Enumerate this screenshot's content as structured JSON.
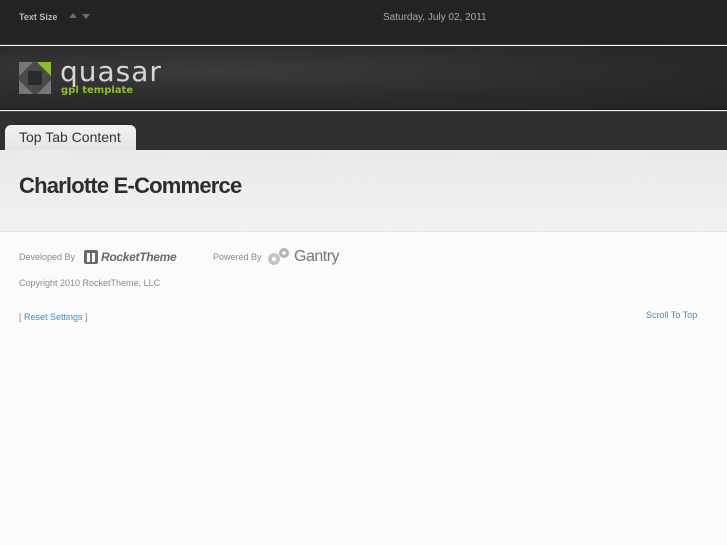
{
  "topbar": {
    "text_size_label": "Text Size",
    "date": "Saturday, July 02, 2011"
  },
  "logo": {
    "name": "quasar",
    "subtitle": "gpl template"
  },
  "tabs": [
    {
      "label": "Top Tab Content"
    }
  ],
  "page": {
    "title": "Charlotte E-Commerce"
  },
  "footer": {
    "developed_by": "Developed By",
    "developer": "RocketTheme",
    "powered_by": "Powered By",
    "framework": "Gantry",
    "copyright": "Copyright 2010 RocketTheme, LLC",
    "reset_open": "[ ",
    "reset_link": "Reset Settings",
    "reset_close": " ]",
    "scroll_top": "Scroll To Top"
  },
  "colors": {
    "link": "#3b8fc7",
    "logo_accent": "#8dbf2a"
  }
}
